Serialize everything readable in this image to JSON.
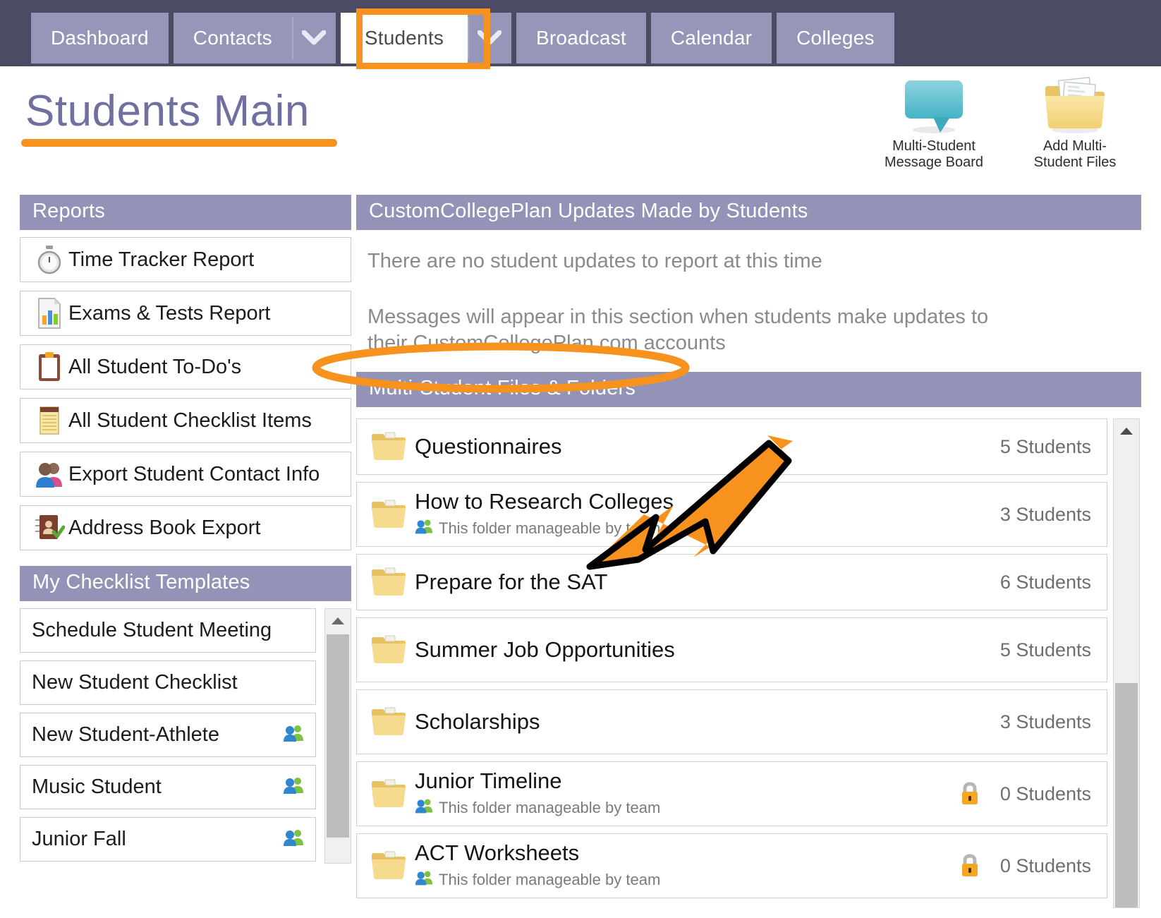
{
  "nav": {
    "tabs": [
      {
        "label": "Dashboard",
        "active": false,
        "caret": false
      },
      {
        "label": "Contacts",
        "active": false,
        "caret": true
      },
      {
        "label": "Students",
        "active": true,
        "caret": true
      },
      {
        "label": "Broadcast",
        "active": false,
        "caret": false
      },
      {
        "label": "Calendar",
        "active": false,
        "caret": false
      },
      {
        "label": "Colleges",
        "active": false,
        "caret": false
      }
    ]
  },
  "header": {
    "title": "Students Main",
    "actions": [
      {
        "label": "Multi-Student\nMessage Board",
        "icon": "speech-bubble-icon"
      },
      {
        "label": "Add Multi-\nStudent Files",
        "icon": "folder-add-files-icon"
      }
    ]
  },
  "sidebar": {
    "reports": {
      "heading": "Reports",
      "items": [
        {
          "label": "Time Tracker Report",
          "icon": "stopwatch-icon"
        },
        {
          "label": "Exams & Tests Report",
          "icon": "bar-chart-document-icon"
        },
        {
          "label": "All Student To-Do's",
          "icon": "clipboard-icon"
        },
        {
          "label": "All Student Checklist Items",
          "icon": "notepad-icon"
        },
        {
          "label": "Export Student Contact Info",
          "icon": "two-people-icon"
        },
        {
          "label": "Address Book Export",
          "icon": "address-book-icon"
        }
      ]
    },
    "templates": {
      "heading": "My Checklist Templates",
      "items": [
        {
          "label": "Schedule Student Meeting",
          "team": false
        },
        {
          "label": "New Student Checklist",
          "team": false
        },
        {
          "label": "New Student-Athlete",
          "team": true
        },
        {
          "label": "Music Student",
          "team": true
        },
        {
          "label": "Junior Fall",
          "team": true
        },
        {
          "label": "",
          "team": false
        }
      ]
    }
  },
  "main": {
    "updates": {
      "heading": "CustomCollegePlan Updates Made by Students",
      "empty_message": "There are no student updates to report at this time",
      "hint_message": "Messages will appear in this section when students make updates to their CustomCollegePlan.com accounts"
    },
    "folders": {
      "heading": "Multi-Student Files & Folders",
      "team_note": "This folder manageable by team",
      "items": [
        {
          "name": "Questionnaires",
          "count": "5 Students",
          "team": false,
          "locked": false
        },
        {
          "name": "How to Research Colleges",
          "count": "3 Students",
          "team": true,
          "locked": false
        },
        {
          "name": "Prepare for the SAT",
          "count": "6 Students",
          "team": false,
          "locked": false
        },
        {
          "name": "Summer Job Opportunities",
          "count": "5 Students",
          "team": false,
          "locked": false
        },
        {
          "name": "Scholarships",
          "count": "3 Students",
          "team": false,
          "locked": false
        },
        {
          "name": "Junior Timeline",
          "count": "0 Students",
          "team": true,
          "locked": true
        },
        {
          "name": "ACT Worksheets",
          "count": "0 Students",
          "team": true,
          "locked": true
        }
      ]
    }
  },
  "annotations": {
    "highlight_color": "#f7921e",
    "tab_box_target": "Students",
    "ellipse_target": "Multi-Student Files & Folders",
    "arrow_target": "Prepare for the SAT",
    "title_underline_target": "Students Main"
  },
  "colors": {
    "nav_background": "#4b4b63",
    "nav_tab": "#9596b8",
    "section_header": "#9293b7",
    "title_text": "#6f6fa0",
    "accent_orange": "#f7921e"
  }
}
